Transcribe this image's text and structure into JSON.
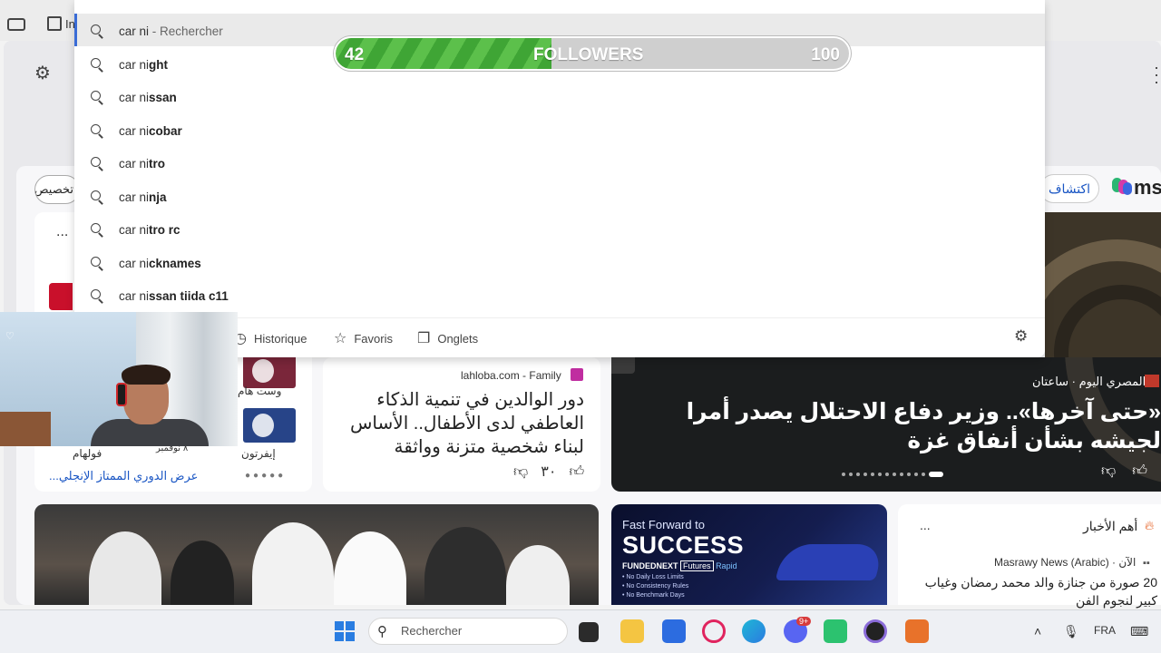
{
  "browser": {
    "partial_tab_label": "In",
    "more_icon": "vertical-dots-icon"
  },
  "address_dropdown": {
    "typed": "car ni",
    "typed_suffix": " - Rechercher",
    "suggestions": [
      {
        "prefix": "car ni",
        "rest": "ght"
      },
      {
        "prefix": "car ni",
        "rest": "ssan"
      },
      {
        "prefix": "car ni",
        "rest": "cobar"
      },
      {
        "prefix": "car ni",
        "rest": "tro"
      },
      {
        "prefix": "car ni",
        "rest": "nja"
      },
      {
        "prefix": "car ni",
        "rest": "tro rc"
      },
      {
        "prefix": "car ni",
        "rest": "cknames"
      },
      {
        "prefix": "car ni",
        "rest": "ssan tiida c11"
      }
    ],
    "tabs": {
      "history": "Historique",
      "favorites": "Favoris",
      "tabs": "Onglets"
    }
  },
  "followers_bar": {
    "current": "42",
    "label": "FOLLOWERS",
    "goal": "100",
    "progress": 0.42,
    "colors": {
      "fill": "#3fa535",
      "track": "#cfcfcf"
    }
  },
  "msn": {
    "logo_text": "ms",
    "discover": "اكتشاف",
    "left_pill": "تخصيص"
  },
  "sports_card": {
    "more": "...",
    "team1": "وست هام",
    "team2": "إيفرتون",
    "team3": "فولهام",
    "date": "٨ نوفمبر",
    "link": "عرض الدوري الممتاز الإنجلي..."
  },
  "article_card": {
    "source": "lahloba.com - Family",
    "title": "دور الوالدين في تنمية الذكاء العاطفي لدى الأطفال.. الأساس لبناء شخصية متزنة وواثقة",
    "likes": "٣٠"
  },
  "hero_news": {
    "source": "المصري اليوم · ساعتان",
    "title": "«حتى آخرها».. وزير دفاع الاحتلال يصدر أمرا لجيشه بشأن أنفاق غزة"
  },
  "ad": {
    "line1": "Fast Forward to",
    "line2": "SUCCESS",
    "brand": "FUNDEDNEXT",
    "brand_tag": "Futures",
    "brand_suffix": "Rapid",
    "bullets": [
      "• No Daily Loss Limits",
      "• No Consistency Rules",
      "• No Benchmark Days"
    ]
  },
  "top_news": {
    "title": "أهم الأخبار",
    "more": "...",
    "source": "Masrawy News (Arabic) · الآن",
    "headline": "20 صورة من جنازة والد محمد رمضان وغياب كبير لنجوم الفن"
  },
  "taskbar": {
    "search_placeholder": "Rechercher",
    "language": "FRA",
    "discord_badge": "9+"
  }
}
